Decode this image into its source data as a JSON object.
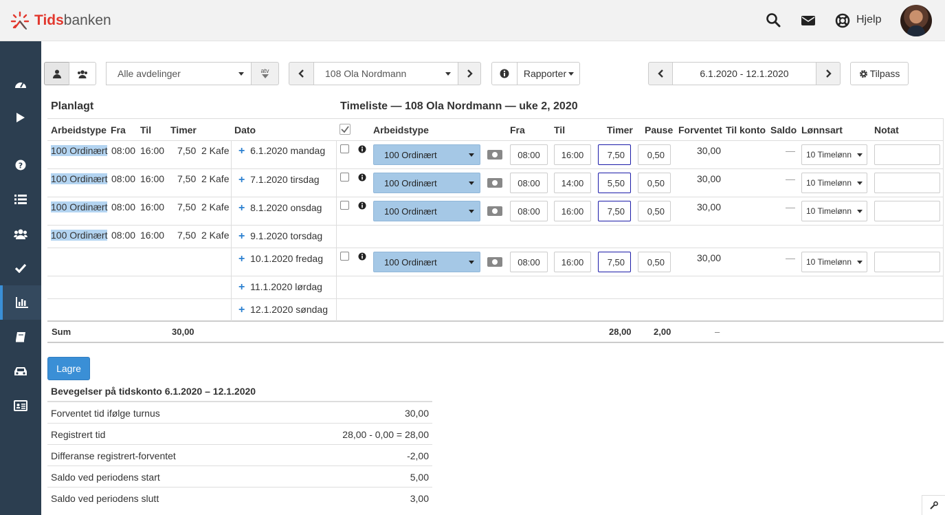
{
  "brand": {
    "bold": "Tids",
    "rest": "banken"
  },
  "header": {
    "help_label": "Hjelp"
  },
  "toolbar": {
    "department": "Alle avdelinger",
    "atv_label": "atv",
    "employee": "108 Ola Nordmann",
    "reports_label": "Rapporter",
    "period": "6.1.2020 - 12.1.2020",
    "customize_label": "Tilpass"
  },
  "planned": {
    "title": "Planlagt",
    "headers": {
      "type": "Arbeidstype",
      "from": "Fra",
      "to": "Til",
      "hours": "Timer",
      "date": "Dato"
    }
  },
  "timesheet": {
    "title": "Timeliste — 108 Ola Nordmann — uke 2, 2020",
    "headers": {
      "type": "Arbeidstype",
      "from": "Fra",
      "to": "Til",
      "hours": "Timer",
      "pause": "Pause",
      "expected": "Forventet",
      "to_account": "Til konto",
      "balance": "Saldo",
      "wage": "Lønnsart",
      "note": "Notat"
    }
  },
  "rows": [
    {
      "planned": {
        "type": "100 Ordinært",
        "from": "08:00",
        "to": "16:00",
        "hours": "7,50",
        "extra": "2 Kafe"
      },
      "date": "6.1.2020 mandag",
      "entry": {
        "type": "100 Ordinært",
        "from": "08:00",
        "to": "16:00",
        "hours": "7,50",
        "pause": "0,50",
        "expected": "30,00",
        "balance": "—",
        "wage": "10 Timelønn"
      }
    },
    {
      "planned": {
        "type": "100 Ordinært",
        "from": "08:00",
        "to": "16:00",
        "hours": "7,50",
        "extra": "2 Kafe"
      },
      "date": "7.1.2020 tirsdag",
      "entry": {
        "type": "100 Ordinært",
        "from": "08:00",
        "to": "14:00",
        "hours": "5,50",
        "pause": "0,50",
        "expected": "30,00",
        "balance": "—",
        "wage": "10 Timelønn"
      }
    },
    {
      "planned": {
        "type": "100 Ordinært",
        "from": "08:00",
        "to": "16:00",
        "hours": "7,50",
        "extra": "2 Kafe"
      },
      "date": "8.1.2020 onsdag",
      "entry": {
        "type": "100 Ordinært",
        "from": "08:00",
        "to": "16:00",
        "hours": "7,50",
        "pause": "0,50",
        "expected": "30,00",
        "balance": "—",
        "wage": "10 Timelønn"
      }
    },
    {
      "planned": {
        "type": "100 Ordinært",
        "from": "08:00",
        "to": "16:00",
        "hours": "7,50",
        "extra": "2 Kafe"
      },
      "date": "9.1.2020 torsdag",
      "entry": null
    },
    {
      "planned": null,
      "date": "10.1.2020 fredag",
      "entry": {
        "type": "100 Ordinært",
        "from": "08:00",
        "to": "16:00",
        "hours": "7,50",
        "pause": "0,50",
        "expected": "30,00",
        "balance": "—",
        "wage": "10 Timelønn"
      }
    },
    {
      "planned": null,
      "date": "11.1.2020 lørdag",
      "entry": null
    },
    {
      "planned": null,
      "date": "12.1.2020 søndag",
      "entry": null
    }
  ],
  "sum": {
    "label": "Sum",
    "planned_hours": "30,00",
    "hours": "28,00",
    "pause": "2,00",
    "expected": "–"
  },
  "save_label": "Lagre",
  "account": {
    "title": "Bevegelser på tidskonto 6.1.2020 – 12.1.2020",
    "lines": [
      {
        "label": "Forventet tid ifølge turnus",
        "value": "30,00"
      },
      {
        "label": "Registrert tid",
        "value": "28,00 - 0,00 = 28,00"
      },
      {
        "label": "Differanse registrert-forventet",
        "value": "-2,00"
      },
      {
        "label": "Saldo ved periodens start",
        "value": "5,00"
      },
      {
        "label": "Saldo ved periodens slutt",
        "value": "3,00"
      }
    ]
  },
  "colors": {
    "sidebar": "#2c3e50",
    "accent": "#3a8fd6",
    "brand_red": "#e2382e",
    "worktype_bg": "#a5c8e6"
  }
}
